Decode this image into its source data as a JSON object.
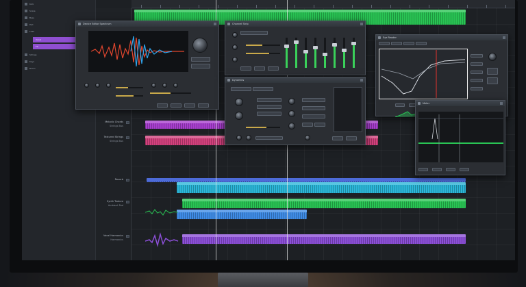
{
  "tracklist": {
    "items": [
      {
        "label": "Kick"
      },
      {
        "label": "Snare"
      },
      {
        "label": "Bass"
      },
      {
        "label": "Pad"
      },
      {
        "label": "Lead"
      },
      {
        "label": "Vocal"
      },
      {
        "label": "FX"
      },
      {
        "label": "Strings"
      },
      {
        "label": "Keys"
      },
      {
        "label": "Room"
      }
    ]
  },
  "tracks": [
    {
      "name": "Melodic Chords",
      "sub": "Strings Bus"
    },
    {
      "name": "Textured Strings",
      "sub": "Strings Bus"
    },
    {
      "name": "Reverb",
      "sub": ""
    },
    {
      "name": "Synth Texture",
      "sub": "Ambient Pad"
    },
    {
      "name": "Vocal Harmonics",
      "sub": "Harmonics"
    }
  ],
  "windows": {
    "spectrum": {
      "title": "Device Editor Spectrum"
    },
    "channel": {
      "title": "Channel Strip"
    },
    "eq": {
      "title": "Eye Reader"
    },
    "meter": {
      "title": "Meter"
    },
    "dynamics": {
      "title": "Dynamics"
    }
  },
  "colors": {
    "green_clip": "#29c454",
    "pink_clip": "#d2417d",
    "magenta_clip": "#a83fcf",
    "blue_clip": "#3f8ce6",
    "cyan_clip": "#2bb7d9",
    "purple_clip": "#8c4fd8",
    "accent": "#8f4fd1"
  },
  "icons": [
    "close-icon",
    "knob-icon",
    "fader-icon",
    "play-icon",
    "mute-icon",
    "solo-icon"
  ]
}
